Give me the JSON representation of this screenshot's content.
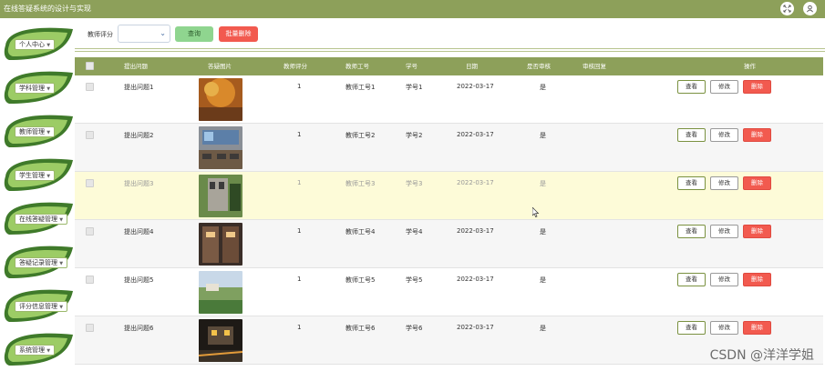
{
  "app": {
    "title": "在线答疑系统的设计与实现"
  },
  "topbar": {
    "icons": [
      "fullscreen-icon",
      "user-icon"
    ]
  },
  "sidebar": {
    "items": [
      {
        "label": "个人中心"
      },
      {
        "label": "学科管理"
      },
      {
        "label": "教师管理"
      },
      {
        "label": "学生管理"
      },
      {
        "label": "在线答疑管理"
      },
      {
        "label": "答疑记录管理"
      },
      {
        "label": "评分信息管理"
      },
      {
        "label": "系统管理"
      }
    ],
    "arrow": "▼"
  },
  "toolbar": {
    "filter_label": "教师评分",
    "select_value": "",
    "search_label": "查询",
    "batch_delete_label": "批量删除"
  },
  "table": {
    "headers": [
      "提出问题",
      "答疑图片",
      "教师评分",
      "教师工号",
      "学号",
      "日期",
      "是否审核",
      "审核回复",
      "操作"
    ],
    "rows": [
      {
        "question": "提出问题1",
        "score": "1",
        "teacher_id": "教师工号1",
        "student_id": "学号1",
        "date": "2022-03-17",
        "reviewed": "是",
        "reply": ""
      },
      {
        "question": "提出问题2",
        "score": "1",
        "teacher_id": "教师工号2",
        "student_id": "学号2",
        "date": "2022-03-17",
        "reviewed": "是",
        "reply": ""
      },
      {
        "question": "提出问题3",
        "score": "1",
        "teacher_id": "教师工号3",
        "student_id": "学号3",
        "date": "2022-03-17",
        "reviewed": "是",
        "reply": ""
      },
      {
        "question": "提出问题4",
        "score": "1",
        "teacher_id": "教师工号4",
        "student_id": "学号4",
        "date": "2022-03-17",
        "reviewed": "是",
        "reply": ""
      },
      {
        "question": "提出问题5",
        "score": "1",
        "teacher_id": "教师工号5",
        "student_id": "学号5",
        "date": "2022-03-17",
        "reviewed": "是",
        "reply": ""
      },
      {
        "question": "提出问题6",
        "score": "1",
        "teacher_id": "教师工号6",
        "student_id": "学号6",
        "date": "2022-03-17",
        "reviewed": "是",
        "reply": ""
      }
    ],
    "actions": {
      "view": "查看",
      "edit": "修改",
      "delete": "删除"
    }
  },
  "watermark": "CSDN @洋洋学姐",
  "colors": {
    "accent": "#8da05a",
    "leaf_dark": "#3f7a2a",
    "leaf_light": "#9ccc65",
    "danger": "#f25a4f",
    "search": "#8fd58f",
    "highlight_row": "#fdfbd8"
  }
}
